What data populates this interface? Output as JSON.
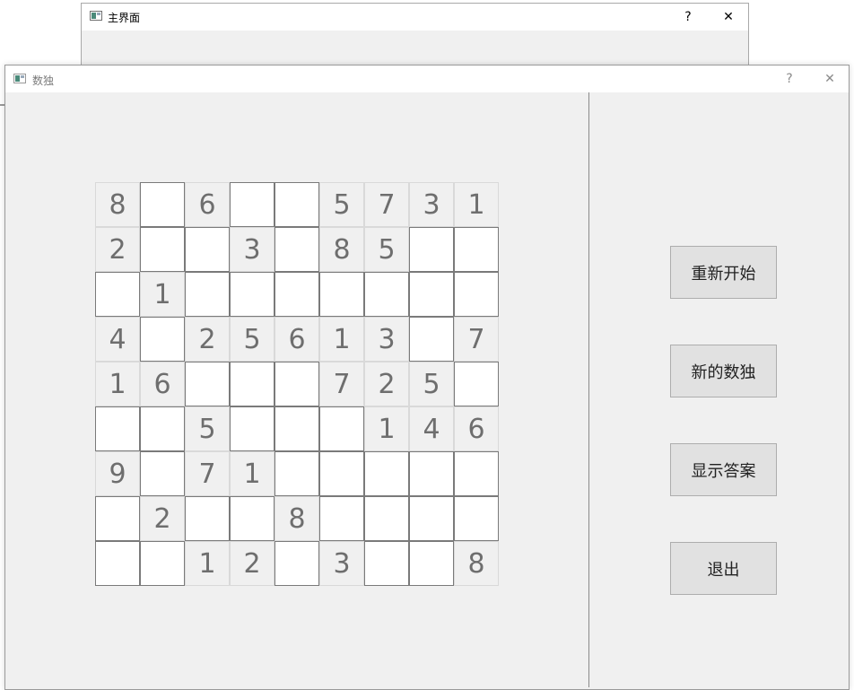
{
  "back_window": {
    "title": "主界面",
    "help_label": "?",
    "close_label": "✕"
  },
  "sudoku_window": {
    "title": "数独",
    "help_label": "?",
    "close_label": "✕"
  },
  "board": {
    "rows": [
      [
        "8",
        "",
        "6",
        "",
        "",
        "5",
        "7",
        "3",
        "1"
      ],
      [
        "2",
        "",
        "",
        "3",
        "",
        "8",
        "5",
        "",
        ""
      ],
      [
        "",
        "1",
        "",
        "",
        "",
        "",
        "",
        "",
        ""
      ],
      [
        "4",
        "",
        "2",
        "5",
        "6",
        "1",
        "3",
        "",
        "7"
      ],
      [
        "1",
        "6",
        "",
        "",
        "",
        "7",
        "2",
        "5",
        ""
      ],
      [
        "",
        "",
        "5",
        "",
        "",
        "",
        "1",
        "4",
        "6"
      ],
      [
        "9",
        "",
        "7",
        "1",
        "",
        "",
        "",
        "",
        ""
      ],
      [
        "",
        "2",
        "",
        "",
        "8",
        "",
        "",
        "",
        ""
      ],
      [
        "",
        "",
        "1",
        "2",
        "",
        "3",
        "",
        "",
        "8"
      ]
    ]
  },
  "buttons": {
    "restart": "重新开始",
    "new_game": "新的数独",
    "show_answer": "显示答案",
    "exit": "退出"
  }
}
